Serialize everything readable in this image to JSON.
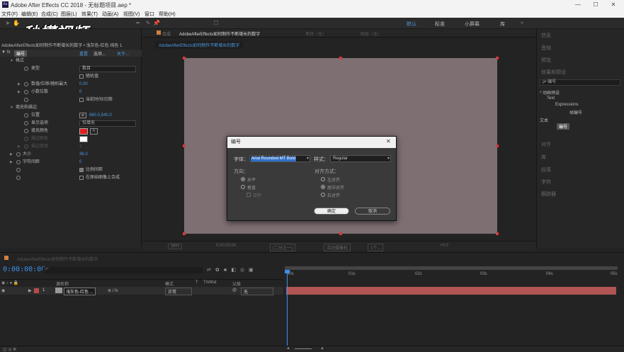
{
  "window": {
    "title": "Adobe After Effects CC 2018 - 无标题项目.aep *",
    "app_icon": "Ae",
    "minimize": "—",
    "maximize": "☐",
    "close": "✕"
  },
  "menu": [
    "文件(F)",
    "编辑(E)",
    "合成(C)",
    "图层(L)",
    "效果(T)",
    "动画(A)",
    "视图(V)",
    "窗口",
    "帮助(H)"
  ],
  "watermark": "秒懂视频",
  "workspaces": {
    "default": "默认",
    "standard": "标准",
    "small": "小屏幕",
    "library": "库"
  },
  "effect_controls": {
    "header": "AdobeAfterEffects如何制作不断增长的数字 • 浅灰色-红色 纯色 1",
    "layer": {
      "name": "编号",
      "reset": "重置",
      "options": "选项...",
      "about": "关于..."
    },
    "rows": [
      {
        "label": "格式",
        "value": ""
      },
      {
        "label": "类型",
        "value": "数目"
      },
      {
        "label": "",
        "value": "随机值"
      },
      {
        "label": "数值/位移/随机最大",
        "value": "0.00"
      },
      {
        "label": "小数位数",
        "value": "0"
      },
      {
        "label": "",
        "value": "当前时间/日期"
      },
      {
        "label": "填充和描边",
        "value": ""
      },
      {
        "label": "位置",
        "value": "960.0,540.0"
      },
      {
        "label": "显示选项",
        "value": "仅填充"
      },
      {
        "label": "填充颜色",
        "value": ""
      },
      {
        "label": "描边颜色",
        "value": ""
      },
      {
        "label": "描边宽度",
        "value": "2"
      },
      {
        "label": "大小",
        "value": "36.0"
      },
      {
        "label": "字符间距",
        "value": "0"
      },
      {
        "label": "",
        "value": "比例间距"
      },
      {
        "label": "",
        "value": "在原始图像上合成"
      }
    ],
    "fill_color": "#e02020",
    "stroke_color": "#ffffff"
  },
  "composition": {
    "tab": "合成",
    "tab_name": "AdobeAfterEffects如何制作不断增长的数字",
    "sub_tab": "AdobeAfterEffects如何制作不断增长的数字",
    "layer_tab": "图层（无）",
    "footage_tab": "素材（无）",
    "zoom": "38%",
    "time": "0:00:00:00",
    "quality": "(二分之一)",
    "camera": "活动摄像机",
    "view": "1个...",
    "offset": "+0.0",
    "canvas_color": "#7d6f72"
  },
  "right_panel": {
    "items": [
      "信息",
      "音频",
      "预览",
      "效果和预设",
      "对齐",
      "库",
      "段落",
      "字符",
      "跟踪器"
    ],
    "search_placeholder": "ρ• 编号",
    "tree": [
      {
        "label": "* 动画预设"
      },
      {
        "label": "Text"
      },
      {
        "label": "Expressions"
      },
      {
        "label": "帧编号"
      },
      {
        "label": "文本"
      },
      {
        "label": "编号"
      }
    ]
  },
  "dialog": {
    "title": "编号",
    "close": "✕",
    "font_label": "字体：",
    "font_value": "Arial Rounded MT Bold",
    "style_label": "样式：",
    "style_value": "Regular",
    "direction_label": "方向：",
    "horizontal": "水平",
    "vertical": "垂直",
    "rotate": "旋转",
    "align_label": "对齐方式：",
    "left": "左对齐",
    "center": "居中对齐",
    "right": "右对齐",
    "ok": "确定",
    "cancel": "取消"
  },
  "timeline": {
    "tab": "AdobeAfterEffects如何制作不断增长的数字",
    "time": "0:00:00:00",
    "search_placeholder": "ρ•",
    "col_source": "源名称",
    "col_mode": "模式",
    "col_t": "T",
    "col_trkmat": "TrkMat",
    "col_parent": "父级",
    "layer_num": "1",
    "layer_name": "浅灰色-红色 ...",
    "layer_mode": "正常",
    "layer_parent": "无",
    "ticks": [
      "00s",
      "01s",
      "02s",
      "03s",
      "04s",
      "05s"
    ],
    "bar_color": "#b05454"
  }
}
